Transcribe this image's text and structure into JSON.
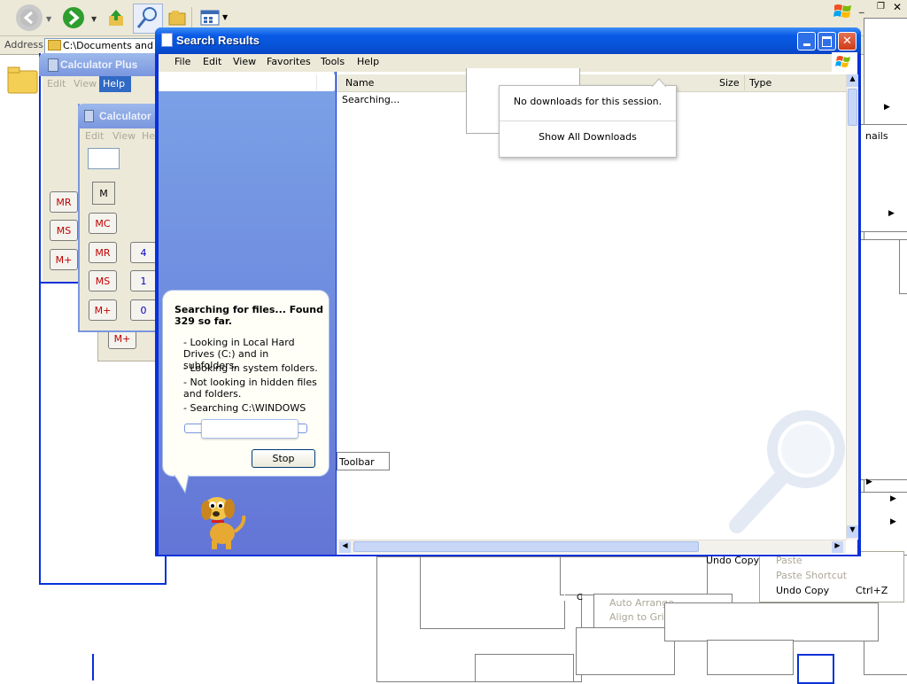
{
  "explorer": {
    "address_label": "Address",
    "address_value": "C:\\Documents and Se"
  },
  "calc_plus": {
    "title": "Calculator Plus",
    "menu": [
      "Edit",
      "View",
      "Help"
    ],
    "buttons": [
      "MR",
      "MS",
      "M+",
      "M+"
    ]
  },
  "calc": {
    "title": "Calculator",
    "menu": [
      "Edit",
      "View",
      "He"
    ],
    "memory_indicator": "M",
    "buttons": [
      "MC",
      "MR",
      "MS",
      "M+"
    ],
    "digits": [
      "4",
      "1",
      "0"
    ]
  },
  "search": {
    "title": "Search Results",
    "menu": [
      "File",
      "Edit",
      "View",
      "Favorites",
      "Tools",
      "Help"
    ],
    "columns": {
      "name": "Name",
      "size": "Size",
      "type": "Type"
    },
    "status_text": "Searching...",
    "balloon": {
      "title": "Searching for files...  Found 329 so far.",
      "lines": [
        "- Looking in Local Hard Drives (C:) and in subfolders.",
        "- Looking in system folders.",
        "- Not looking in hidden files and folders.",
        "- Searching C:\\WINDOWS"
      ],
      "stop_label": "Stop"
    },
    "toolbar_tooltip": "Toolbar"
  },
  "downloads_popup": {
    "message": "No downloads for this session.",
    "show_all": "Show All Downloads"
  },
  "context_menu": {
    "items": [
      {
        "label": "Paste",
        "shortcut": ""
      },
      {
        "label": "Paste Shortcut",
        "shortcut": ""
      },
      {
        "label": "Undo Copy",
        "shortcut": "Ctrl+Z"
      }
    ],
    "behind_items": [
      "Undo Copy",
      "Auto Arrange",
      "Align to Grid"
    ],
    "side_fragment": "nails"
  },
  "colors": {
    "xp_blue": "#0843c6",
    "task_pane": "#6f8fe0",
    "calc_red": "#c00000"
  }
}
